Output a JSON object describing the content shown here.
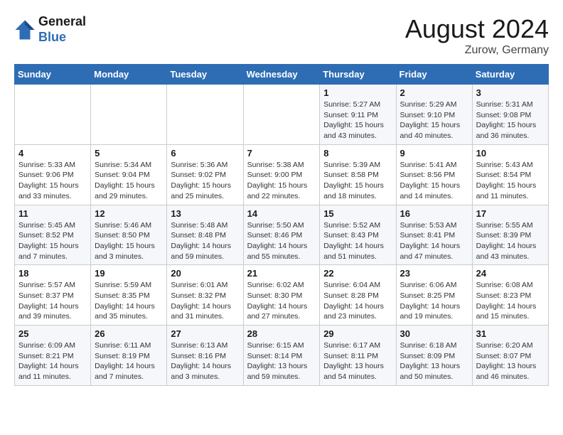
{
  "header": {
    "logo_general": "General",
    "logo_blue": "Blue",
    "month_title": "August 2024",
    "subtitle": "Zurow, Germany"
  },
  "weekdays": [
    "Sunday",
    "Monday",
    "Tuesday",
    "Wednesday",
    "Thursday",
    "Friday",
    "Saturday"
  ],
  "weeks": [
    [
      {
        "day": "",
        "info": ""
      },
      {
        "day": "",
        "info": ""
      },
      {
        "day": "",
        "info": ""
      },
      {
        "day": "",
        "info": ""
      },
      {
        "day": "1",
        "info": "Sunrise: 5:27 AM\nSunset: 9:11 PM\nDaylight: 15 hours\nand 43 minutes."
      },
      {
        "day": "2",
        "info": "Sunrise: 5:29 AM\nSunset: 9:10 PM\nDaylight: 15 hours\nand 40 minutes."
      },
      {
        "day": "3",
        "info": "Sunrise: 5:31 AM\nSunset: 9:08 PM\nDaylight: 15 hours\nand 36 minutes."
      }
    ],
    [
      {
        "day": "4",
        "info": "Sunrise: 5:33 AM\nSunset: 9:06 PM\nDaylight: 15 hours\nand 33 minutes."
      },
      {
        "day": "5",
        "info": "Sunrise: 5:34 AM\nSunset: 9:04 PM\nDaylight: 15 hours\nand 29 minutes."
      },
      {
        "day": "6",
        "info": "Sunrise: 5:36 AM\nSunset: 9:02 PM\nDaylight: 15 hours\nand 25 minutes."
      },
      {
        "day": "7",
        "info": "Sunrise: 5:38 AM\nSunset: 9:00 PM\nDaylight: 15 hours\nand 22 minutes."
      },
      {
        "day": "8",
        "info": "Sunrise: 5:39 AM\nSunset: 8:58 PM\nDaylight: 15 hours\nand 18 minutes."
      },
      {
        "day": "9",
        "info": "Sunrise: 5:41 AM\nSunset: 8:56 PM\nDaylight: 15 hours\nand 14 minutes."
      },
      {
        "day": "10",
        "info": "Sunrise: 5:43 AM\nSunset: 8:54 PM\nDaylight: 15 hours\nand 11 minutes."
      }
    ],
    [
      {
        "day": "11",
        "info": "Sunrise: 5:45 AM\nSunset: 8:52 PM\nDaylight: 15 hours\nand 7 minutes."
      },
      {
        "day": "12",
        "info": "Sunrise: 5:46 AM\nSunset: 8:50 PM\nDaylight: 15 hours\nand 3 minutes."
      },
      {
        "day": "13",
        "info": "Sunrise: 5:48 AM\nSunset: 8:48 PM\nDaylight: 14 hours\nand 59 minutes."
      },
      {
        "day": "14",
        "info": "Sunrise: 5:50 AM\nSunset: 8:46 PM\nDaylight: 14 hours\nand 55 minutes."
      },
      {
        "day": "15",
        "info": "Sunrise: 5:52 AM\nSunset: 8:43 PM\nDaylight: 14 hours\nand 51 minutes."
      },
      {
        "day": "16",
        "info": "Sunrise: 5:53 AM\nSunset: 8:41 PM\nDaylight: 14 hours\nand 47 minutes."
      },
      {
        "day": "17",
        "info": "Sunrise: 5:55 AM\nSunset: 8:39 PM\nDaylight: 14 hours\nand 43 minutes."
      }
    ],
    [
      {
        "day": "18",
        "info": "Sunrise: 5:57 AM\nSunset: 8:37 PM\nDaylight: 14 hours\nand 39 minutes."
      },
      {
        "day": "19",
        "info": "Sunrise: 5:59 AM\nSunset: 8:35 PM\nDaylight: 14 hours\nand 35 minutes."
      },
      {
        "day": "20",
        "info": "Sunrise: 6:01 AM\nSunset: 8:32 PM\nDaylight: 14 hours\nand 31 minutes."
      },
      {
        "day": "21",
        "info": "Sunrise: 6:02 AM\nSunset: 8:30 PM\nDaylight: 14 hours\nand 27 minutes."
      },
      {
        "day": "22",
        "info": "Sunrise: 6:04 AM\nSunset: 8:28 PM\nDaylight: 14 hours\nand 23 minutes."
      },
      {
        "day": "23",
        "info": "Sunrise: 6:06 AM\nSunset: 8:25 PM\nDaylight: 14 hours\nand 19 minutes."
      },
      {
        "day": "24",
        "info": "Sunrise: 6:08 AM\nSunset: 8:23 PM\nDaylight: 14 hours\nand 15 minutes."
      }
    ],
    [
      {
        "day": "25",
        "info": "Sunrise: 6:09 AM\nSunset: 8:21 PM\nDaylight: 14 hours\nand 11 minutes."
      },
      {
        "day": "26",
        "info": "Sunrise: 6:11 AM\nSunset: 8:19 PM\nDaylight: 14 hours\nand 7 minutes."
      },
      {
        "day": "27",
        "info": "Sunrise: 6:13 AM\nSunset: 8:16 PM\nDaylight: 14 hours\nand 3 minutes."
      },
      {
        "day": "28",
        "info": "Sunrise: 6:15 AM\nSunset: 8:14 PM\nDaylight: 13 hours\nand 59 minutes."
      },
      {
        "day": "29",
        "info": "Sunrise: 6:17 AM\nSunset: 8:11 PM\nDaylight: 13 hours\nand 54 minutes."
      },
      {
        "day": "30",
        "info": "Sunrise: 6:18 AM\nSunset: 8:09 PM\nDaylight: 13 hours\nand 50 minutes."
      },
      {
        "day": "31",
        "info": "Sunrise: 6:20 AM\nSunset: 8:07 PM\nDaylight: 13 hours\nand 46 minutes."
      }
    ]
  ]
}
